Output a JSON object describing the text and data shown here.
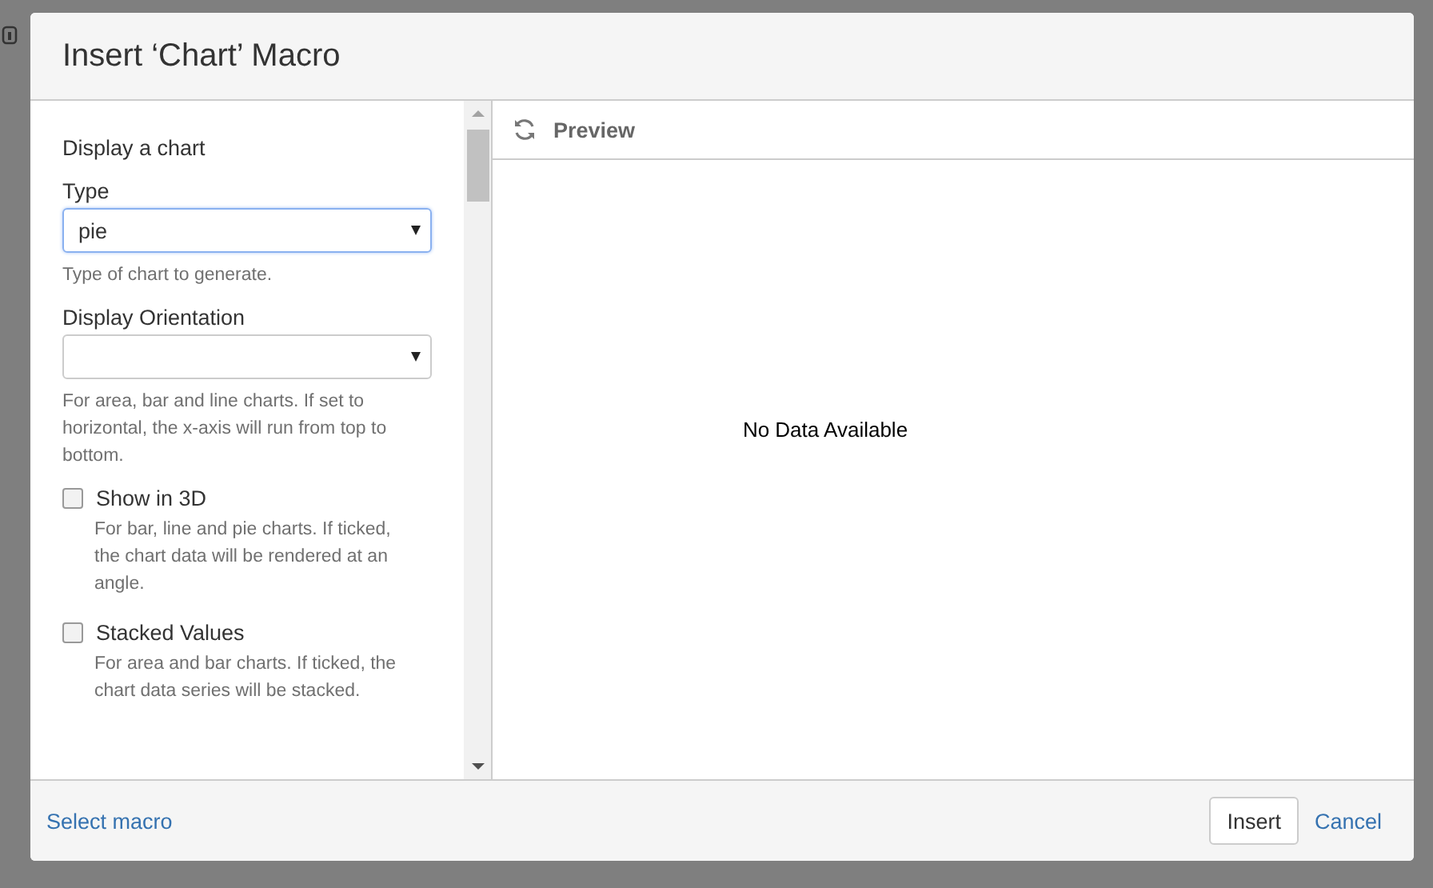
{
  "dialog": {
    "title": "Insert ‘Chart’ Macro"
  },
  "form": {
    "heading": "Display a chart",
    "fields": [
      {
        "kind": "select",
        "label": "Type",
        "value": "pie",
        "focused": true,
        "help": "Type of chart to generate."
      },
      {
        "kind": "select",
        "label": "Display Orientation",
        "focused": false,
        "help": "For area, bar and line charts. If set to horizontal, the x-axis will run from top to bottom."
      },
      {
        "kind": "checkbox",
        "label": "Show in 3D",
        "checked": false,
        "help": "For bar, line and pie charts. If ticked, the chart data will be rendered at an angle."
      },
      {
        "kind": "checkbox",
        "label": "Stacked Values",
        "checked": false,
        "help": "For area and bar charts. If ticked, the chart data series will be stacked."
      }
    ]
  },
  "preview": {
    "title": "Preview",
    "message": "No Data Available"
  },
  "footer": {
    "link": "Select macro",
    "buttons": [
      {
        "label": "Insert",
        "kind": "button"
      },
      {
        "label": "Cancel",
        "kind": "link"
      }
    ]
  }
}
